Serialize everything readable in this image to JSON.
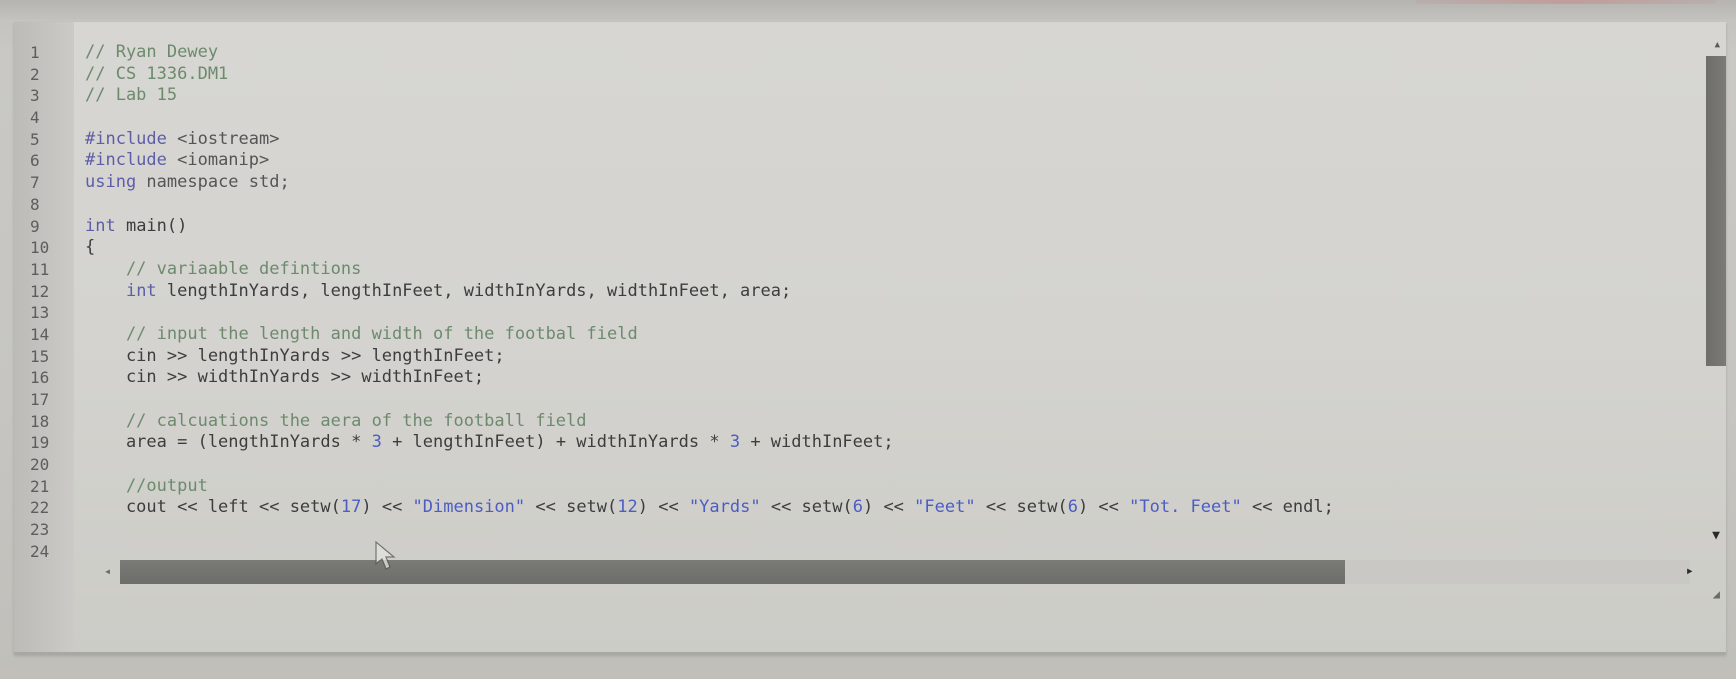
{
  "editor": {
    "lines": [
      {
        "n": "1",
        "tokens": [
          {
            "t": "// Ryan Dewey",
            "k": "comment"
          }
        ]
      },
      {
        "n": "2",
        "tokens": [
          {
            "t": "// CS 1336.DM1",
            "k": "comment"
          }
        ]
      },
      {
        "n": "3",
        "tokens": [
          {
            "t": "// Lab 15",
            "k": "comment"
          }
        ]
      },
      {
        "n": "4",
        "tokens": []
      },
      {
        "n": "5",
        "tokens": [
          {
            "t": "#include",
            "k": "keyword"
          },
          {
            "t": " <iostream>",
            "k": "op"
          }
        ]
      },
      {
        "n": "6",
        "tokens": [
          {
            "t": "#include",
            "k": "keyword"
          },
          {
            "t": " <iomanip>",
            "k": "op"
          }
        ]
      },
      {
        "n": "7",
        "tokens": [
          {
            "t": "using",
            "k": "keyword"
          },
          {
            "t": " namespace std;",
            "k": "op"
          }
        ]
      },
      {
        "n": "8",
        "tokens": []
      },
      {
        "n": "9",
        "tokens": [
          {
            "t": "int",
            "k": "keyword"
          },
          {
            "t": " main()",
            "k": "plain"
          }
        ]
      },
      {
        "n": "10",
        "tokens": [
          {
            "t": "{",
            "k": "plain"
          }
        ]
      },
      {
        "n": "11",
        "tokens": [
          {
            "t": "    // variaable defintions",
            "k": "comment"
          }
        ]
      },
      {
        "n": "12",
        "tokens": [
          {
            "t": "    ",
            "k": "plain"
          },
          {
            "t": "int",
            "k": "keyword"
          },
          {
            "t": " lengthInYards, lengthInFeet, widthInYards, widthInFeet, area;",
            "k": "plain"
          }
        ]
      },
      {
        "n": "13",
        "tokens": []
      },
      {
        "n": "14",
        "tokens": [
          {
            "t": "    // input the length and width of the footbal field",
            "k": "comment"
          }
        ]
      },
      {
        "n": "15",
        "tokens": [
          {
            "t": "    cin >> lengthInYards >> lengthInFeet;",
            "k": "plain"
          }
        ]
      },
      {
        "n": "16",
        "tokens": [
          {
            "t": "    cin >> widthInYards >> widthInFeet;",
            "k": "plain"
          }
        ]
      },
      {
        "n": "17",
        "tokens": []
      },
      {
        "n": "18",
        "tokens": [
          {
            "t": "    // calcuations the aera of the football field",
            "k": "comment"
          }
        ]
      },
      {
        "n": "19",
        "tokens": [
          {
            "t": "    area = (lengthInYards * ",
            "k": "plain"
          },
          {
            "t": "3",
            "k": "number"
          },
          {
            "t": " + lengthInFeet) + widthInYards * ",
            "k": "plain"
          },
          {
            "t": "3",
            "k": "number"
          },
          {
            "t": " + widthInFeet;",
            "k": "plain"
          }
        ]
      },
      {
        "n": "20",
        "tokens": []
      },
      {
        "n": "21",
        "tokens": [
          {
            "t": "    //output",
            "k": "comment"
          }
        ]
      },
      {
        "n": "22",
        "tokens": [
          {
            "t": "    cout << left << setw(",
            "k": "plain"
          },
          {
            "t": "17",
            "k": "number"
          },
          {
            "t": ") << ",
            "k": "plain"
          },
          {
            "t": "\"Dimension\"",
            "k": "string"
          },
          {
            "t": " << setw(",
            "k": "plain"
          },
          {
            "t": "12",
            "k": "number"
          },
          {
            "t": ") << ",
            "k": "plain"
          },
          {
            "t": "\"Yards\"",
            "k": "string"
          },
          {
            "t": " << setw(",
            "k": "plain"
          },
          {
            "t": "6",
            "k": "number"
          },
          {
            "t": ") << ",
            "k": "plain"
          },
          {
            "t": "\"Feet\"",
            "k": "string"
          },
          {
            "t": " << setw(",
            "k": "plain"
          },
          {
            "t": "6",
            "k": "number"
          },
          {
            "t": ") << ",
            "k": "plain"
          },
          {
            "t": "\"Tot. Feet\"",
            "k": "string"
          },
          {
            "t": " << endl;",
            "k": "plain"
          }
        ]
      },
      {
        "n": "23",
        "tokens": []
      },
      {
        "n": "24",
        "tokens": []
      }
    ]
  },
  "scrollbars": {
    "horizontal": {
      "left_arrow": "◂",
      "right_arrow": "▸",
      "thumb_fraction": 0.78
    },
    "vertical": {
      "up_arrow": "▲",
      "down_arrow": "▼",
      "thumb_fraction": 0.6
    },
    "resize_grip": "◢"
  },
  "colors": {
    "comment": "#6d8a6d",
    "keyword": "#5d5da8",
    "string": "#4c5dc2",
    "plain": "#3d3d3d",
    "background": "#d4d3cf"
  }
}
